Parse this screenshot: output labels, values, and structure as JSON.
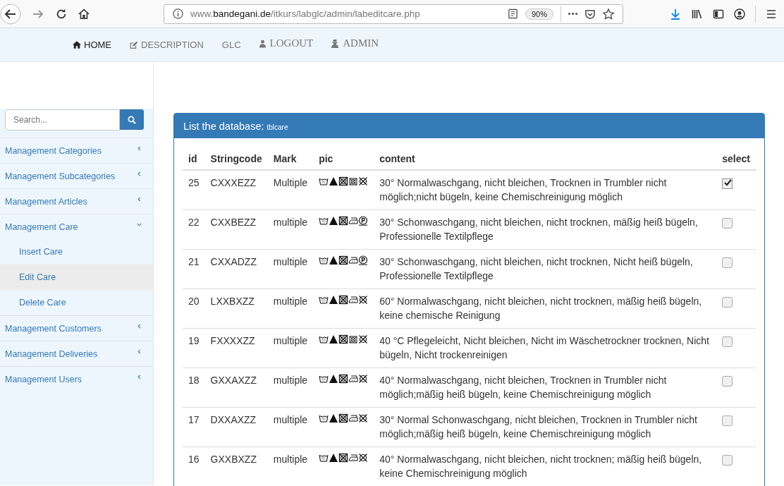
{
  "browser": {
    "url": "www.**bandegani.de**/itkurs/labglc/admin/labeditcare.php",
    "zoom": "90%"
  },
  "nav": [
    {
      "label": "HOME",
      "selected": true
    },
    {
      "label": "DESCRIPTION",
      "selected": false
    },
    {
      "label": "GLC",
      "selected": false
    },
    {
      "label": "LOGOUT",
      "selected": false
    },
    {
      "label": "ADMIN",
      "selected": false
    }
  ],
  "sidebar": {
    "search": {
      "placeholder": "Search..."
    },
    "items": [
      {
        "label": "Management Categories",
        "expanded": false
      },
      {
        "label": "Management Subcategories",
        "expanded": false
      },
      {
        "label": "Management Articles",
        "expanded": false
      },
      {
        "label": "Management Care",
        "expanded": true,
        "children": [
          {
            "label": "Insert Care",
            "selected": false
          },
          {
            "label": "Edit Care",
            "selected": true
          },
          {
            "label": "Delete Care",
            "selected": false
          }
        ]
      },
      {
        "label": "Management Customers",
        "expanded": false
      },
      {
        "label": "Management Deliveries",
        "expanded": false
      },
      {
        "label": "Management Users",
        "expanded": false
      }
    ]
  },
  "panel": {
    "title": "List the database:",
    "table_name": "tblcare",
    "columns": [
      "id",
      "Stringcode",
      "Mark",
      "pic",
      "content",
      "select"
    ],
    "rows": [
      {
        "id": "25",
        "code": "CXXXEZZ",
        "mark": "Multiple",
        "pic": [
          {
            "kind": "wash"
          },
          {
            "kind": "bleach-no"
          },
          {
            "kind": "dry-no"
          },
          {
            "kind": "tumble-no"
          },
          {
            "kind": "dryclean-no"
          }
        ],
        "content": "30° Normalwaschgang, nicht bleichen, Trocknen in Trumbler nicht möglich;nicht bügeln, keine Chemischreinigung möglich",
        "checked": true
      },
      {
        "id": "22",
        "code": "CXXBEZZ",
        "mark": "multiple",
        "pic": [
          {
            "kind": "wash"
          },
          {
            "kind": "bleach-no"
          },
          {
            "kind": "dry-no"
          },
          {
            "kind": "iron"
          },
          {
            "kind": "professional"
          }
        ],
        "content": "30° Schonwaschgang, nicht bleichen, nicht trocknen, mäßig heiß bügeln, Professionelle Textilpflege",
        "checked": false
      },
      {
        "id": "21",
        "code": "CXXADZZ",
        "mark": "multiple",
        "pic": [
          {
            "kind": "wash"
          },
          {
            "kind": "bleach-no"
          },
          {
            "kind": "dry-no"
          },
          {
            "kind": "iron"
          },
          {
            "kind": "professional"
          }
        ],
        "content": "30° Schonwaschgang, nicht bleichen, nicht trocknen, Nicht heiß bügeln, Professionelle Textilpflege",
        "checked": false
      },
      {
        "id": "20",
        "code": "LXXBXZZ",
        "mark": "multiple",
        "pic": [
          {
            "kind": "wash"
          },
          {
            "kind": "bleach-no"
          },
          {
            "kind": "dry-no"
          },
          {
            "kind": "iron"
          },
          {
            "kind": "dryclean-no"
          }
        ],
        "content": "60° Normalwaschgang, nicht bleichen, nicht trocknen, mäßig heiß bügeln, keine chemische Reinigung",
        "checked": false
      },
      {
        "id": "19",
        "code": "FXXXXZZ",
        "mark": "multiple",
        "pic": [
          {
            "kind": "wash"
          },
          {
            "kind": "bleach-no"
          },
          {
            "kind": "dry-no"
          },
          {
            "kind": "tumble-no"
          },
          {
            "kind": "dryclean-no"
          }
        ],
        "content": "40 °C Pflegeleicht, Nicht bleichen, Nicht im Wäschetrockner trocknen, Nicht bügeln, Nicht trockenreinigen",
        "checked": false
      },
      {
        "id": "18",
        "code": "GXXAXZZ",
        "mark": "multiple",
        "pic": [
          {
            "kind": "wash"
          },
          {
            "kind": "bleach-no"
          },
          {
            "kind": "dry-no"
          },
          {
            "kind": "iron"
          },
          {
            "kind": "dryclean-no"
          }
        ],
        "content": "40° Normalwaschgang, nicht bleichen, Trocknen in Trumbler nicht möglich;mäßig heiß bügeln, keine Chemischreinigung möglich",
        "checked": false
      },
      {
        "id": "17",
        "code": "DXXAXZZ",
        "mark": "multiple",
        "pic": [
          {
            "kind": "wash"
          },
          {
            "kind": "bleach-no"
          },
          {
            "kind": "dry-no"
          },
          {
            "kind": "iron"
          },
          {
            "kind": "dryclean-no"
          }
        ],
        "content": "30° Normal Schonwaschgang, nicht bleichen, Trocknen in Trumbler nicht möglich;mäßig heiß bügeln, keine Chemischreinigung möglich",
        "checked": false
      },
      {
        "id": "16",
        "code": "GXXBXZZ",
        "mark": "multiple",
        "pic": [
          {
            "kind": "wash"
          },
          {
            "kind": "bleach-no"
          },
          {
            "kind": "dry-no"
          },
          {
            "kind": "iron"
          },
          {
            "kind": "dryclean-no"
          }
        ],
        "content": "40° Normalwaschgang, nicht bleichen, nicht trocknen; mäßig heiß bügeln, keine Chemischreinigung möglich",
        "checked": false
      }
    ]
  }
}
